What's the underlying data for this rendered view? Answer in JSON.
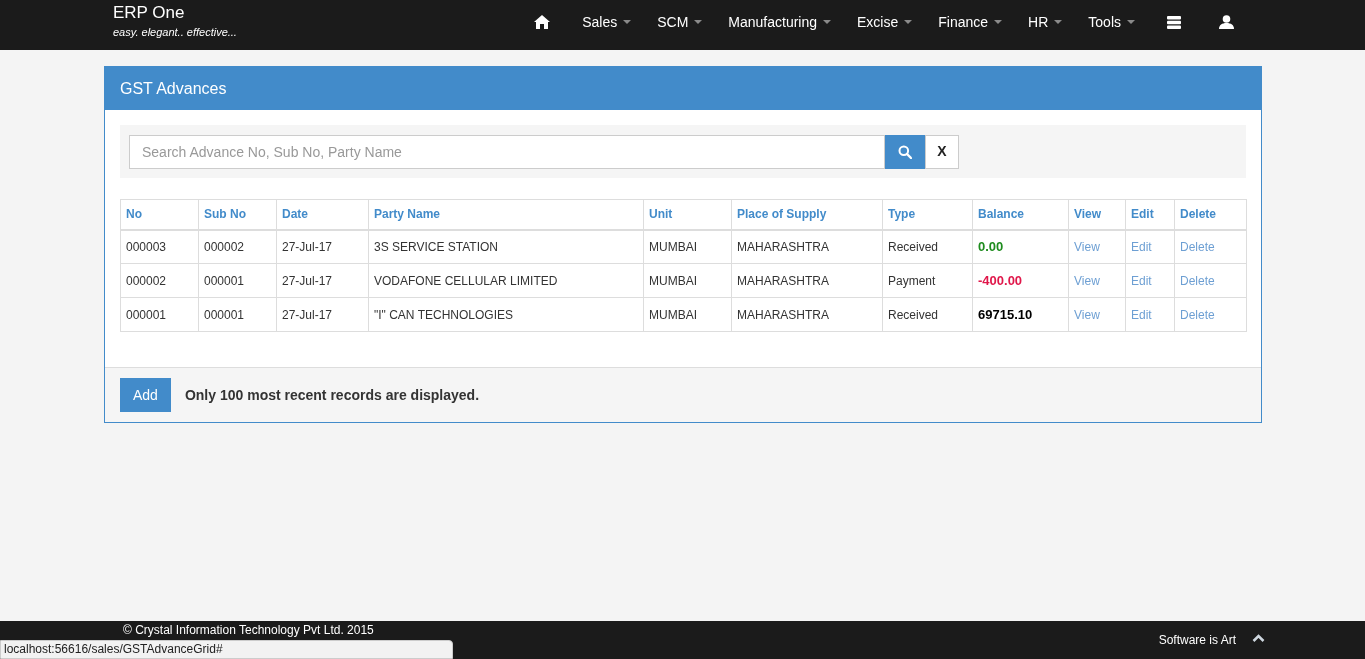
{
  "navbar": {
    "brand": "ERP One",
    "tagline": "easy. elegant.. effective...",
    "items": [
      {
        "kind": "home"
      },
      {
        "kind": "menu",
        "label": "Sales"
      },
      {
        "kind": "menu",
        "label": "SCM"
      },
      {
        "kind": "menu",
        "label": "Manufacturing"
      },
      {
        "kind": "menu",
        "label": "Excise"
      },
      {
        "kind": "menu",
        "label": "Finance"
      },
      {
        "kind": "menu",
        "label": "HR"
      },
      {
        "kind": "menu",
        "label": "Tools"
      },
      {
        "kind": "stack"
      },
      {
        "kind": "user"
      }
    ]
  },
  "panel": {
    "title": "GST Advances",
    "search": {
      "placeholder": "Search Advance No, Sub No, Party Name",
      "clear_label": "X"
    },
    "table": {
      "columns": [
        "No",
        "Sub No",
        "Date",
        "Party Name",
        "Unit",
        "Place of Supply",
        "Type",
        "Balance",
        "View",
        "Edit",
        "Delete"
      ],
      "rows": [
        {
          "no": "000003",
          "sub_no": "000002",
          "date": "27-Jul-17",
          "party_name": "3S SERVICE STATION",
          "unit": "MUMBAI",
          "place_of_supply": "MAHARASHTRA",
          "type": "Received",
          "balance": "0.00",
          "color": "#1e8c1e",
          "view": "View",
          "edit": "Edit",
          "delete": "Delete"
        },
        {
          "no": "000002",
          "sub_no": "000001",
          "date": "27-Jul-17",
          "party_name": "VODAFONE CELLULAR LIMITED",
          "unit": "MUMBAI",
          "place_of_supply": "MAHARASHTRA",
          "type": "Payment",
          "balance": "-400.00",
          "color": "#e0174a",
          "view": "View",
          "edit": "Edit",
          "delete": "Delete"
        },
        {
          "no": "000001",
          "sub_no": "000001",
          "date": "27-Jul-17",
          "party_name": "\"I\" CAN TECHNOLOGIES",
          "unit": "MUMBAI",
          "place_of_supply": "MAHARASHTRA",
          "type": "Received",
          "balance": "69715.10",
          "color": "#000000",
          "view": "View",
          "edit": "Edit",
          "delete": "Delete"
        }
      ]
    },
    "add_button": "Add",
    "note": "Only 100 most recent records are displayed."
  },
  "footer": {
    "copyright": "© Crystal Information Technology Pvt Ltd. 2015",
    "slogan": "Software is Art"
  },
  "status_bar": {
    "url": "localhost:56616/sales/GSTAdvanceGrid#"
  }
}
